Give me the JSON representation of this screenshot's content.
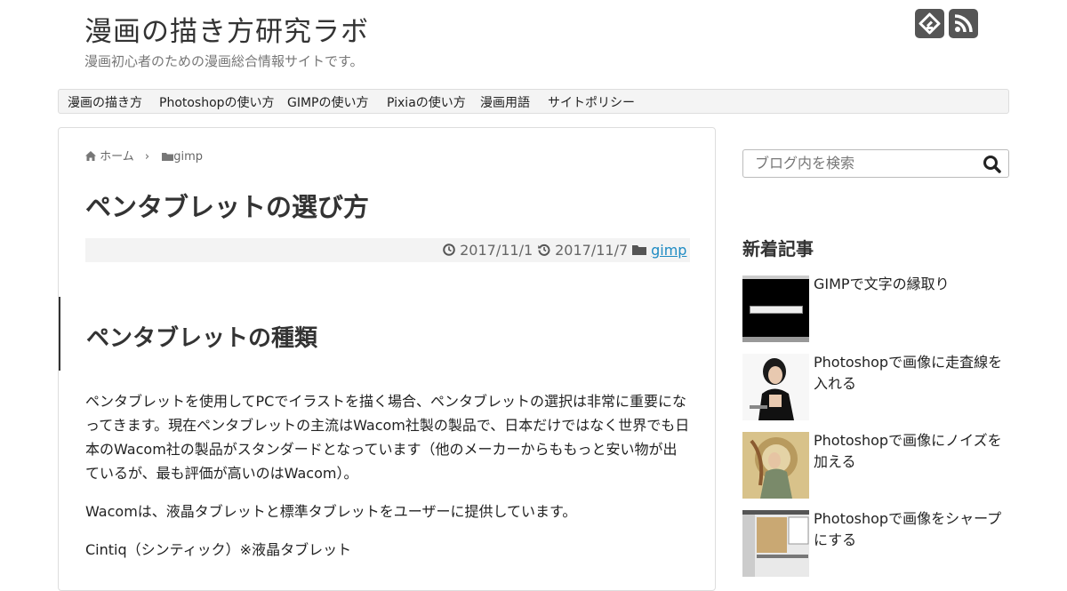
{
  "site": {
    "title": "漫画の描き方研究ラボ",
    "description": "漫画初心者のための漫画総合情報サイトです。"
  },
  "sns": [
    {
      "icon": "feedly-icon"
    },
    {
      "icon": "rss-icon"
    }
  ],
  "nav": {
    "items": [
      {
        "label": "漫画の描き方"
      },
      {
        "label": "Photoshopの使い方"
      },
      {
        "label": "GIMPの使い方"
      },
      {
        "label": "Pixiaの使い方"
      },
      {
        "label": "漫画用語"
      },
      {
        "label": "サイトポリシー"
      }
    ]
  },
  "breadcrumb": {
    "home": "ホーム",
    "category": "gimp"
  },
  "post": {
    "title": "ペンタブレットの選び方",
    "published": "2017/11/1",
    "updated": "2017/11/7",
    "category": "gimp",
    "heading": "ペンタブレットの種類",
    "paragraphs": [
      "ペンタブレットを使用してPCでイラストを描く場合、ペンタブレットの選択は非常に重要になってきます。現在ペンタブレットの主流はWacom社製の製品で、日本だけではなく世界でも日本のWacom社の製品がスタンダードとなっています（他のメーカーからももっと安い物が出ているが、最も評価が高いのはWacom）。",
      "Wacomは、液晶タブレットと標準タブレットをユーザーに提供しています。",
      "Cintiq（シンティック）※液晶タブレット"
    ]
  },
  "search": {
    "placeholder": "ブログ内を検索"
  },
  "sidebar": {
    "recent_title": "新着記事",
    "recent": [
      {
        "title": "GIMPで文字の縁取り"
      },
      {
        "title": "Photoshopで画像に走査線を入れる"
      },
      {
        "title": "Photoshopで画像にノイズを加える"
      },
      {
        "title": "Photoshopで画像をシャープにする"
      }
    ]
  },
  "colors": {
    "link": "#1e8bc3",
    "icon_bg": "#555555"
  }
}
